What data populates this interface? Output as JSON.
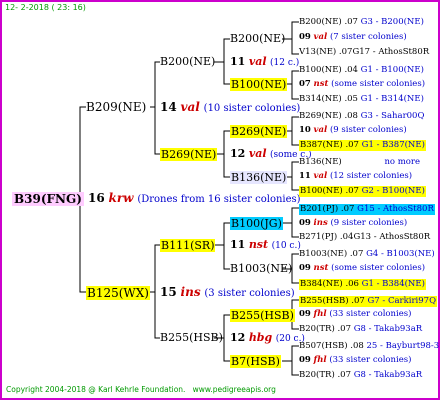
{
  "header": {
    "date": "12-  2-2018 ( 23: 16)"
  },
  "root": {
    "id": "B39(FNG)",
    "year": "16",
    "brand": "krw",
    "note": "(Drones from 16 sister colonies)"
  },
  "gen2": [
    {
      "id": "B209(NE)",
      "year": "14",
      "brand": "val",
      "note": "(10 sister colonies)"
    },
    {
      "id": "B125(WX)",
      "year": "15",
      "brand": "ins",
      "note": "(3 sister colonies)"
    }
  ],
  "gen3": [
    {
      "id": "B200(NE)",
      "year": "11",
      "brand": "val",
      "note": "(12 c.)"
    },
    {
      "id": "B269(NE)",
      "year": "12",
      "brand": "val",
      "note": "(some c.)"
    },
    {
      "id": "B111(SR)",
      "year": "11",
      "brand": "nst",
      "note": "(10 c.)"
    },
    {
      "id": "B255(HSB)",
      "year": "12",
      "brand": "hbg",
      "note": "(20 c.)"
    }
  ],
  "gen4": [
    {
      "id": "B200(NE)"
    },
    {
      "id": "B100(NE)"
    },
    {
      "id": "B269(NE)"
    },
    {
      "id": "B136(NE)"
    },
    {
      "id": "B100(JG)"
    },
    {
      "id": "B1003(NE)"
    },
    {
      "id": "B255(HSB)"
    },
    {
      "id": "B7(HSB)"
    }
  ],
  "gen5": [
    {
      "top": "B200(NE) .07",
      "top_extra": "G3 - B200(NE)",
      "year": "09",
      "brand": "val",
      "note": "(7 sister colonies)",
      "bottom": "V13(NE) .07G17 - AthosSt80R"
    },
    {
      "top": "B100(NE) .04",
      "top_extra": "G1 - B100(NE)",
      "year": "07",
      "brand": "nst",
      "note": "(some sister colonies)",
      "bottom": "B314(NE) .05",
      "bottom_extra": "G1 - B314(NE)"
    },
    {
      "top": "B269(NE) .08",
      "top_extra": "G3 - Sahar00Q",
      "year": "10",
      "brand": "val",
      "note": "(9 sister colonies)",
      "bottom": "B387(NE) .07",
      "bottom_extra": "G1 - B387(NE)"
    },
    {
      "top": "B136(NE)",
      "top_extra": "no more",
      "year": "11",
      "brand": "val",
      "note": "(12 sister colonies)",
      "bottom": "B100(NE) .07",
      "bottom_extra": "G2 - B100(NE)"
    },
    {
      "top": "B201(PJ) .07",
      "top_extra": "G15 - AthosSt80R",
      "year": "09",
      "brand": "ins",
      "note": "(9 sister colonies)",
      "bottom": "B271(PJ) .04G13 - AthosSt80R"
    },
    {
      "top": "B1003(NE) .07",
      "top_extra": "G4 - B1003(NE)",
      "year": "09",
      "brand": "nst",
      "note": "(some sister colonies)",
      "bottom": "B384(NE) .06",
      "bottom_extra": "G1 - B384(NE)"
    },
    {
      "top": "B255(HSB) .07",
      "top_extra": "G7 - Carkiri97Q",
      "year": "09",
      "brand": "fhl",
      "note": "(33 sister colonies)",
      "bottom": "B20(TR) .07",
      "bottom_extra": "G8 - Takab93aR"
    },
    {
      "top": "B507(HSB) .08",
      "top_extra": "25 - Bayburt98-3",
      "year": "09",
      "brand": "fhl",
      "note": "(33 sister colonies)",
      "bottom": "B20(TR) .07",
      "bottom_extra": "G8 - Takab93aR"
    }
  ],
  "footer": {
    "copyright": "Copyright 2004-2018 @ Karl Kehrle Foundation.",
    "url": "www.pedigreeapis.org"
  }
}
